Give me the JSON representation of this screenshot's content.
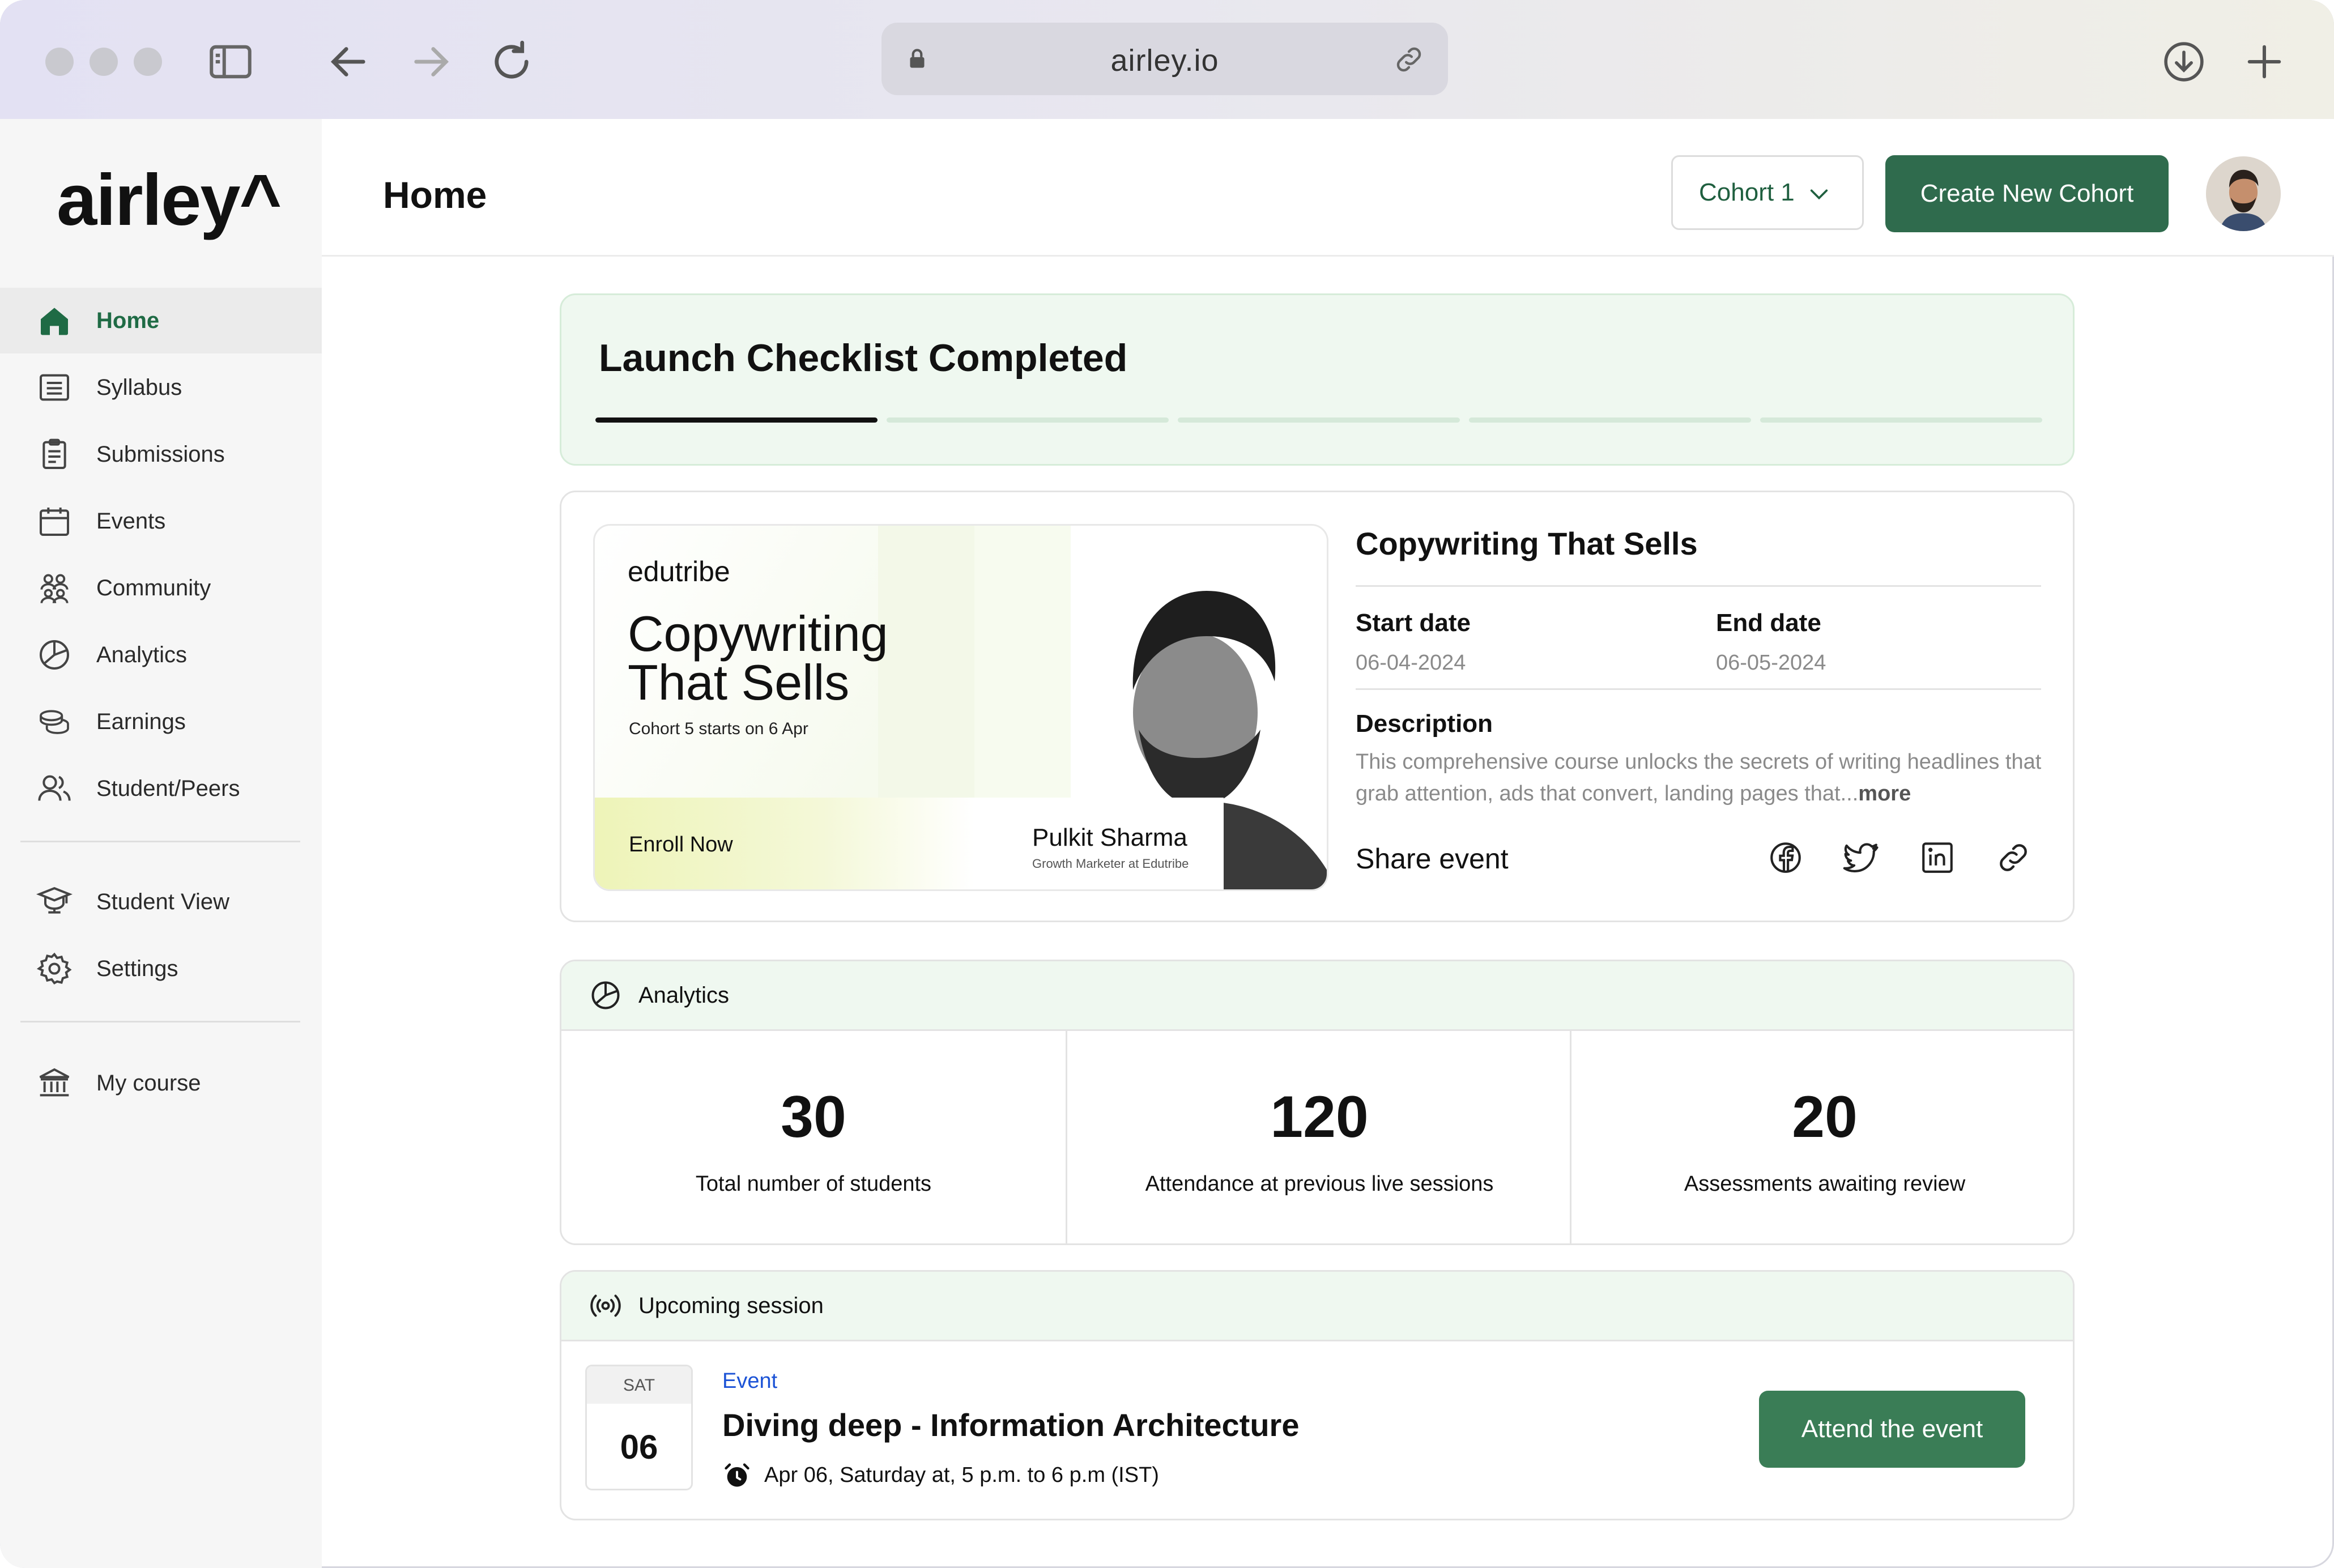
{
  "browser": {
    "url": "airley.io"
  },
  "app": {
    "logo": "airley^"
  },
  "sidebar": {
    "items": [
      {
        "label": "Home",
        "icon": "home-icon",
        "active": true
      },
      {
        "label": "Syllabus",
        "icon": "list-icon"
      },
      {
        "label": "Submissions",
        "icon": "clipboard-icon"
      },
      {
        "label": "Events",
        "icon": "calendar-icon"
      },
      {
        "label": "Community",
        "icon": "community-icon"
      },
      {
        "label": "Analytics",
        "icon": "pie-chart-icon"
      },
      {
        "label": "Earnings",
        "icon": "coins-icon"
      },
      {
        "label": "Student/Peers",
        "icon": "users-icon"
      },
      {
        "label": "Student View",
        "icon": "graduation-cap-icon"
      },
      {
        "label": "Settings",
        "icon": "gear-icon"
      },
      {
        "label": "My course",
        "icon": "institution-icon"
      }
    ]
  },
  "header": {
    "title": "Home",
    "cohort_select": "Cohort 1",
    "create_button": "Create New Cohort"
  },
  "checklist": {
    "title": "Launch Checklist Completed",
    "segments_total": 5,
    "segments_completed": 1
  },
  "event": {
    "banner": {
      "brand": "edutribe",
      "title": "Copywriting That Sells",
      "subtitle": "Cohort 5 starts on 6 Apr",
      "enroll": "Enroll Now",
      "speaker_name": "Pulkit Sharma",
      "speaker_role": "Growth Marketer at Edutribe"
    },
    "title": "Copywriting That Sells",
    "start_label": "Start date",
    "start_value": "06-04-2024",
    "end_label": "End date",
    "end_value": "06-05-2024",
    "description_label": "Description",
    "description": "This comprehensive course unlocks the secrets of writing headlines that grab attention, ads that convert, landing pages that...",
    "more": "more",
    "share_label": "Share event",
    "share_icons": [
      "facebook-icon",
      "twitter-icon",
      "linkedin-icon",
      "link-icon"
    ]
  },
  "analytics": {
    "label": "Analytics",
    "stats": [
      {
        "value": "30",
        "label": "Total number of students"
      },
      {
        "value": "120",
        "label": "Attendance at previous live sessions"
      },
      {
        "value": "20",
        "label": "Assessments awaiting review"
      }
    ]
  },
  "session": {
    "label": "Upcoming session",
    "day_of_week": "SAT",
    "day": "06",
    "tag": "Event",
    "title": "Diving deep - Information Architecture",
    "time": "Apr 06, Saturday at, 5 p.m. to 6 p.m (IST)",
    "button": "Attend the event"
  },
  "colors": {
    "brand_green": "#2f6b4d",
    "light_green": "#eff8f0",
    "link_blue": "#1c53d6"
  }
}
